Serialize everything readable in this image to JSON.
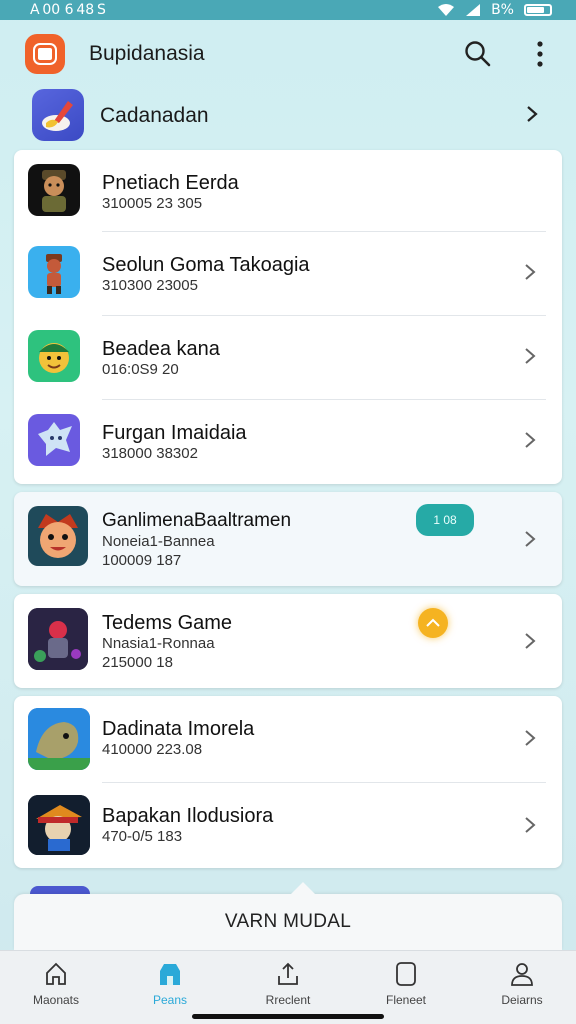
{
  "status_bar": {
    "time": "A 00 6 48 S",
    "battery_text": "B%"
  },
  "header": {
    "app_title": "Bupidanasia",
    "search_icon": "search-icon",
    "more_icon": "more-vertical-icon",
    "logo_color": "#f0622a"
  },
  "category": {
    "title": "Cadanadan",
    "icon": "brush-icon"
  },
  "list_group_1": [
    {
      "title": "Pnetiach Eerda",
      "subtitle": "310005 23 305",
      "thumb_bg": "#111111",
      "has_chevron": false
    },
    {
      "title": "Seolun Goma Takoagia",
      "subtitle": "310300 23005",
      "thumb_bg": "#3ab0ee",
      "has_chevron": true
    },
    {
      "title": "Beadea kana",
      "subtitle": "016:0S9 20",
      "thumb_bg": "#2ec27e",
      "has_chevron": true
    },
    {
      "title": "Furgan Imaidaia",
      "subtitle": "318000 38302",
      "thumb_bg": "#6a5ae0",
      "has_chevron": true
    }
  ],
  "featured_1": {
    "title": "GanlimenaBaaltramen",
    "publisher": "Noneia1-Bannea",
    "meta": "100009 187",
    "badge": "1 08",
    "badge_color": "#26aaa6",
    "thumb_bg": "#1f4a5a"
  },
  "featured_2": {
    "title": "Tedems Game",
    "publisher": "Nnasia1-Ronnaa",
    "meta": "215000 18",
    "badge_color": "#f5b321",
    "thumb_bg": "#1a1a2a"
  },
  "list_group_2": [
    {
      "title": "Dadinata Imorela",
      "subtitle": "410000 223.08",
      "thumb_bg": "#1f6fd0"
    },
    {
      "title": "Bapakan Ilodusiora",
      "subtitle": "470-0/5 183",
      "thumb_bg": "#0f1e30"
    }
  ],
  "bottom_sheet": {
    "label": "VARN MUDAL"
  },
  "bottom_nav": [
    {
      "label": "Maonats",
      "icon": "home-icon",
      "active": false
    },
    {
      "label": "Peans",
      "icon": "store-icon",
      "active": true
    },
    {
      "label": "Rreclent",
      "icon": "upload-icon",
      "active": false
    },
    {
      "label": "Fleneet",
      "icon": "tablet-icon",
      "active": false
    },
    {
      "label": "Deiarns",
      "icon": "profile-icon",
      "active": false
    }
  ],
  "accent_color": "#2aa9d8"
}
